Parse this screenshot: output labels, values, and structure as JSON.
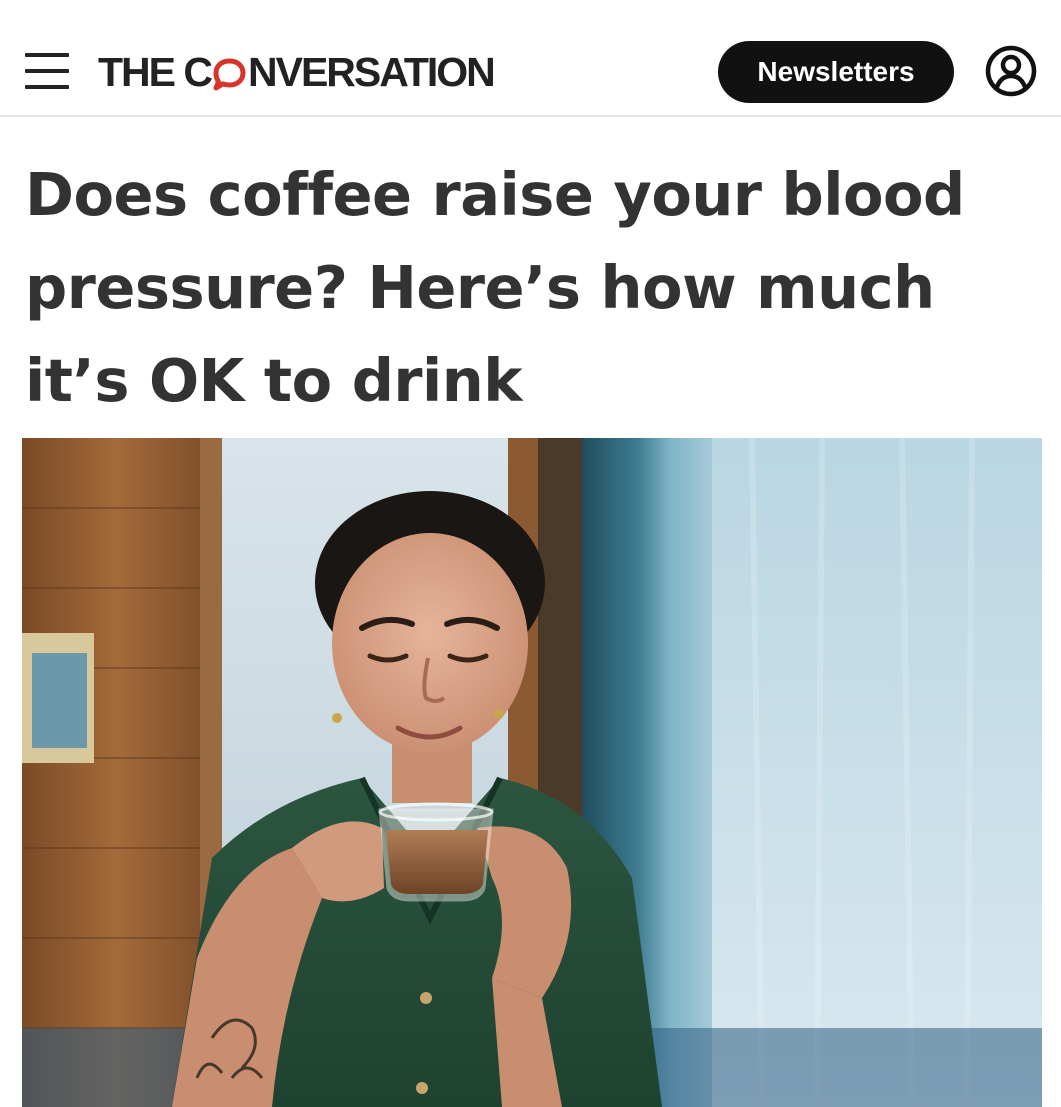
{
  "header": {
    "logo_text_before": "THE C",
    "logo_text_after": "NVERSATION",
    "newsletters_label": "Newsletters",
    "brand_color": "#d8352a"
  },
  "icons": {
    "menu": "hamburger-menu-icon",
    "account": "user-account-icon",
    "logo_mark": "speech-bubble-icon"
  },
  "article": {
    "title": "Does coffee raise your blood pressure? Here’s how much it’s OK to drink"
  }
}
